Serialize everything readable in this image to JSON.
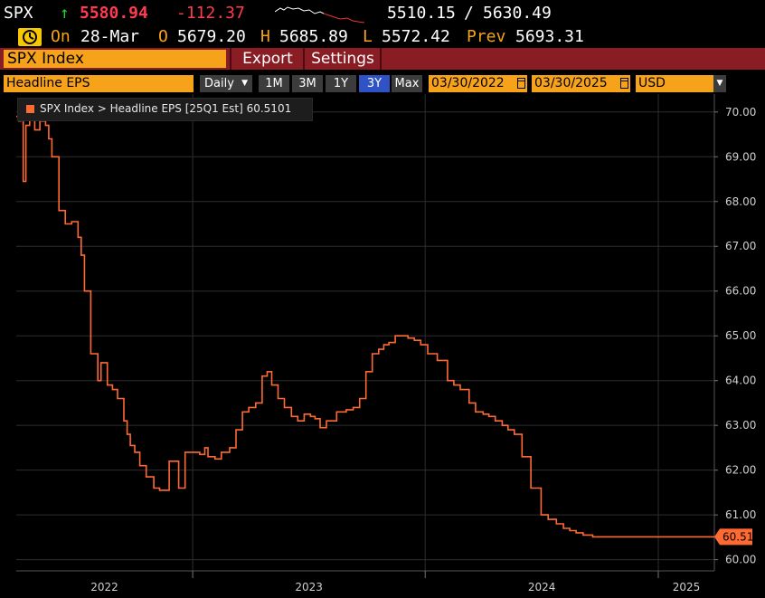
{
  "quote": {
    "ticker": "SPX",
    "direction_glyph": "↑",
    "last": "5580.94",
    "change": "-112.37",
    "range_low": "5510.15",
    "range_sep": "/",
    "range_high": "5630.49",
    "on_label": "On",
    "date": "28-Mar",
    "open_label": "O",
    "open": "5679.20",
    "high_label": "H",
    "high": "5685.89",
    "low_label": "L",
    "low": "5572.42",
    "prev_label": "Prev",
    "prev": "5693.31"
  },
  "toolbar": {
    "security": "SPX Index",
    "export": "Export",
    "settings": "Settings"
  },
  "controls": {
    "field": "Headline EPS",
    "frequency": "Daily",
    "periods": [
      "1M",
      "3M",
      "1Y",
      "3Y",
      "Max"
    ],
    "selected_period": "3Y",
    "start_date": "03/30/2022",
    "end_date": "03/30/2025",
    "currency": "USD"
  },
  "legend": {
    "text": "SPX Index > Headline EPS [25Q1 Est]  60.5101"
  },
  "colors": {
    "series": "#ff6a33",
    "accent_orange": "#f7a21b",
    "toolbar_red": "#8a1c24",
    "up_green": "#25d425",
    "down_red": "#ff3b4d"
  },
  "chart_data": {
    "type": "line",
    "series": [
      {
        "name": "SPX Index > Headline EPS [25Q1 Est]",
        "x": [
          "2022-03-30",
          "2022-04-03",
          "2022-04-06",
          "2022-04-08",
          "2022-04-10",
          "2022-04-14",
          "2022-04-20",
          "2022-04-28",
          "2022-05-06",
          "2022-05-15",
          "2022-05-20",
          "2022-05-25",
          "2022-06-05",
          "2022-06-15",
          "2022-06-25",
          "2022-07-05",
          "2022-07-10",
          "2022-07-15",
          "2022-07-25",
          "2022-08-05",
          "2022-08-10",
          "2022-08-20",
          "2022-08-28",
          "2022-09-05",
          "2022-09-15",
          "2022-09-20",
          "2022-09-25",
          "2022-10-02",
          "2022-10-10",
          "2022-10-20",
          "2022-11-01",
          "2022-11-10",
          "2022-11-25",
          "2022-12-10",
          "2022-12-20",
          "2023-01-05",
          "2023-01-12",
          "2023-01-20",
          "2023-01-25",
          "2023-02-05",
          "2023-02-15",
          "2023-02-28",
          "2023-03-10",
          "2023-03-20",
          "2023-03-30",
          "2023-04-10",
          "2023-04-20",
          "2023-04-28",
          "2023-05-05",
          "2023-05-15",
          "2023-05-25",
          "2023-06-05",
          "2023-06-15",
          "2023-06-25",
          "2023-07-05",
          "2023-07-12",
          "2023-07-20",
          "2023-07-30",
          "2023-08-15",
          "2023-08-30",
          "2023-09-10",
          "2023-09-20",
          "2023-09-30",
          "2023-10-10",
          "2023-10-20",
          "2023-10-28",
          "2023-11-05",
          "2023-11-15",
          "2023-11-25",
          "2023-12-05",
          "2023-12-15",
          "2023-12-25",
          "2024-01-05",
          "2024-01-20",
          "2024-02-05",
          "2024-02-15",
          "2024-02-25",
          "2024-03-10",
          "2024-03-20",
          "2024-04-01",
          "2024-04-10",
          "2024-04-20",
          "2024-05-01",
          "2024-05-10",
          "2024-05-20",
          "2024-06-01",
          "2024-06-15",
          "2024-07-01",
          "2024-07-12",
          "2024-07-25",
          "2024-08-05",
          "2024-08-15",
          "2024-08-25",
          "2024-09-05",
          "2024-09-20",
          "2024-10-05",
          "2024-10-15",
          "2024-10-25",
          "2024-11-05",
          "2024-11-20",
          "2024-12-05",
          "2024-12-15",
          "2024-12-25",
          "2025-01-01",
          "2025-01-05",
          "2025-01-10",
          "2025-01-15",
          "2025-01-20",
          "2025-01-28",
          "2025-02-05",
          "2025-02-15",
          "2025-03-01",
          "2025-03-15",
          "2025-03-30"
        ],
        "y": [
          69.9,
          69.8,
          70.0,
          69.9,
          68.45,
          69.7,
          69.9,
          69.6,
          69.8,
          69.7,
          69.4,
          69.0,
          67.8,
          67.5,
          67.55,
          67.2,
          66.8,
          66.0,
          64.6,
          64.0,
          64.4,
          63.9,
          63.8,
          63.6,
          63.1,
          62.8,
          62.55,
          62.4,
          62.1,
          61.85,
          61.6,
          61.55,
          62.2,
          61.6,
          62.4,
          62.4,
          62.35,
          62.5,
          62.3,
          62.25,
          62.4,
          62.5,
          62.9,
          63.3,
          63.4,
          63.5,
          64.1,
          64.2,
          63.9,
          63.6,
          63.4,
          63.2,
          63.1,
          63.25,
          63.2,
          63.15,
          62.95,
          63.1,
          63.3,
          63.35,
          63.4,
          63.6,
          64.2,
          64.6,
          64.7,
          64.8,
          64.85,
          65.0,
          65.0,
          64.95,
          64.9,
          64.8,
          64.6,
          64.45,
          64.0,
          63.9,
          63.8,
          63.5,
          63.3,
          63.25,
          63.2,
          63.1,
          63.0,
          62.9,
          62.8,
          62.3,
          61.6,
          61.0,
          60.9,
          60.8,
          60.7,
          60.65,
          60.6,
          60.55,
          60.51,
          60.51,
          60.51,
          60.51,
          60.51,
          60.51,
          60.51,
          60.51,
          60.51,
          60.51,
          60.51,
          60.51,
          60.51,
          60.51,
          60.51,
          60.51,
          60.51,
          60.51,
          60.51,
          60.51
        ]
      }
    ],
    "xlim": [
      "2022-03-30",
      "2025-03-30"
    ],
    "ylim": [
      59.75,
      70.4
    ],
    "y_ticks": [
      60.0,
      61.0,
      62.0,
      63.0,
      64.0,
      65.0,
      66.0,
      67.0,
      68.0,
      69.0,
      70.0
    ],
    "y_tick_labels": [
      "60.00",
      "61.00",
      "62.00",
      "63.00",
      "64.00",
      "65.00",
      "66.00",
      "67.00",
      "68.00",
      "69.00",
      "70.00"
    ],
    "x_tick_labels": [
      "2022",
      "2023",
      "2024",
      "2025"
    ],
    "last_value_label": "60.51",
    "grid": true,
    "y_axis_side": "right"
  }
}
